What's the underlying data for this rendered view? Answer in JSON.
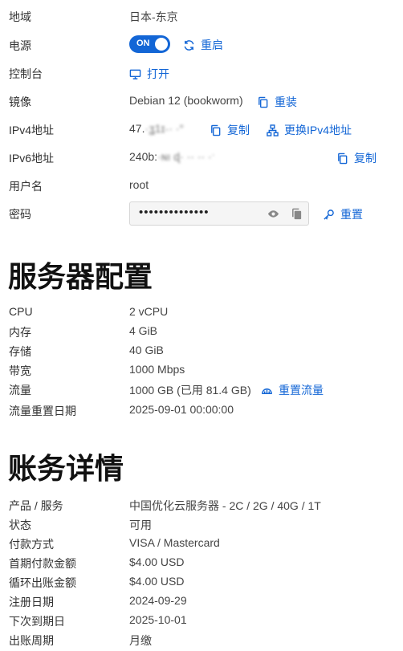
{
  "instance": {
    "region": {
      "label": "地域",
      "value": "日本-东京"
    },
    "power": {
      "label": "电源",
      "toggle": "ON",
      "action": "重启"
    },
    "console": {
      "label": "控制台",
      "action": "打开"
    },
    "image": {
      "label": "镜像",
      "value": "Debian 12 (bookworm)",
      "action": "重装"
    },
    "ipv4": {
      "label": "IPv4地址",
      "value": "47.",
      "masked": "·ʓ1ɪ˴· ·°",
      "copy": "复制",
      "change": "更换IPv4地址"
    },
    "ipv6": {
      "label": "IPv6地址",
      "value": "240b:",
      "masked": "·ɴı   ɖ·   ··   ··             ·ˑ",
      "copy": "复制"
    },
    "username": {
      "label": "用户名",
      "value": "root"
    },
    "password": {
      "label": "密码",
      "dots": "••••••••••••••",
      "action": "重置"
    }
  },
  "server_config": {
    "title": "服务器配置",
    "rows": [
      {
        "label": "CPU",
        "value": "2 vCPU"
      },
      {
        "label": "内存",
        "value": "4 GiB"
      },
      {
        "label": "存储",
        "value": "40 GiB"
      },
      {
        "label": "带宽",
        "value": "1000 Mbps"
      },
      {
        "label": "流量",
        "value": "1000 GB (已用 81.4 GB)",
        "action": "重置流量"
      },
      {
        "label": "流量重置日期",
        "value": "2025-09-01 00:00:00"
      }
    ]
  },
  "billing": {
    "title": "账务详情",
    "rows": [
      {
        "label": "产品 / 服务",
        "value": "中国优化云服务器 - 2C / 2G / 40G / 1T"
      },
      {
        "label": "状态",
        "value": "可用"
      },
      {
        "label": "付款方式",
        "value": "VISA / Mastercard"
      },
      {
        "label": "首期付款金额",
        "value": "$4.00 USD"
      },
      {
        "label": "循环出账金额",
        "value": "$4.00 USD"
      },
      {
        "label": "注册日期",
        "value": "2024-09-29"
      },
      {
        "label": "下次到期日",
        "value": "2025-10-01"
      },
      {
        "label": "出账周期",
        "value": "月缴"
      }
    ]
  },
  "colors": {
    "accent": "#1366d6",
    "heading": "#111111",
    "text": "#444444"
  }
}
